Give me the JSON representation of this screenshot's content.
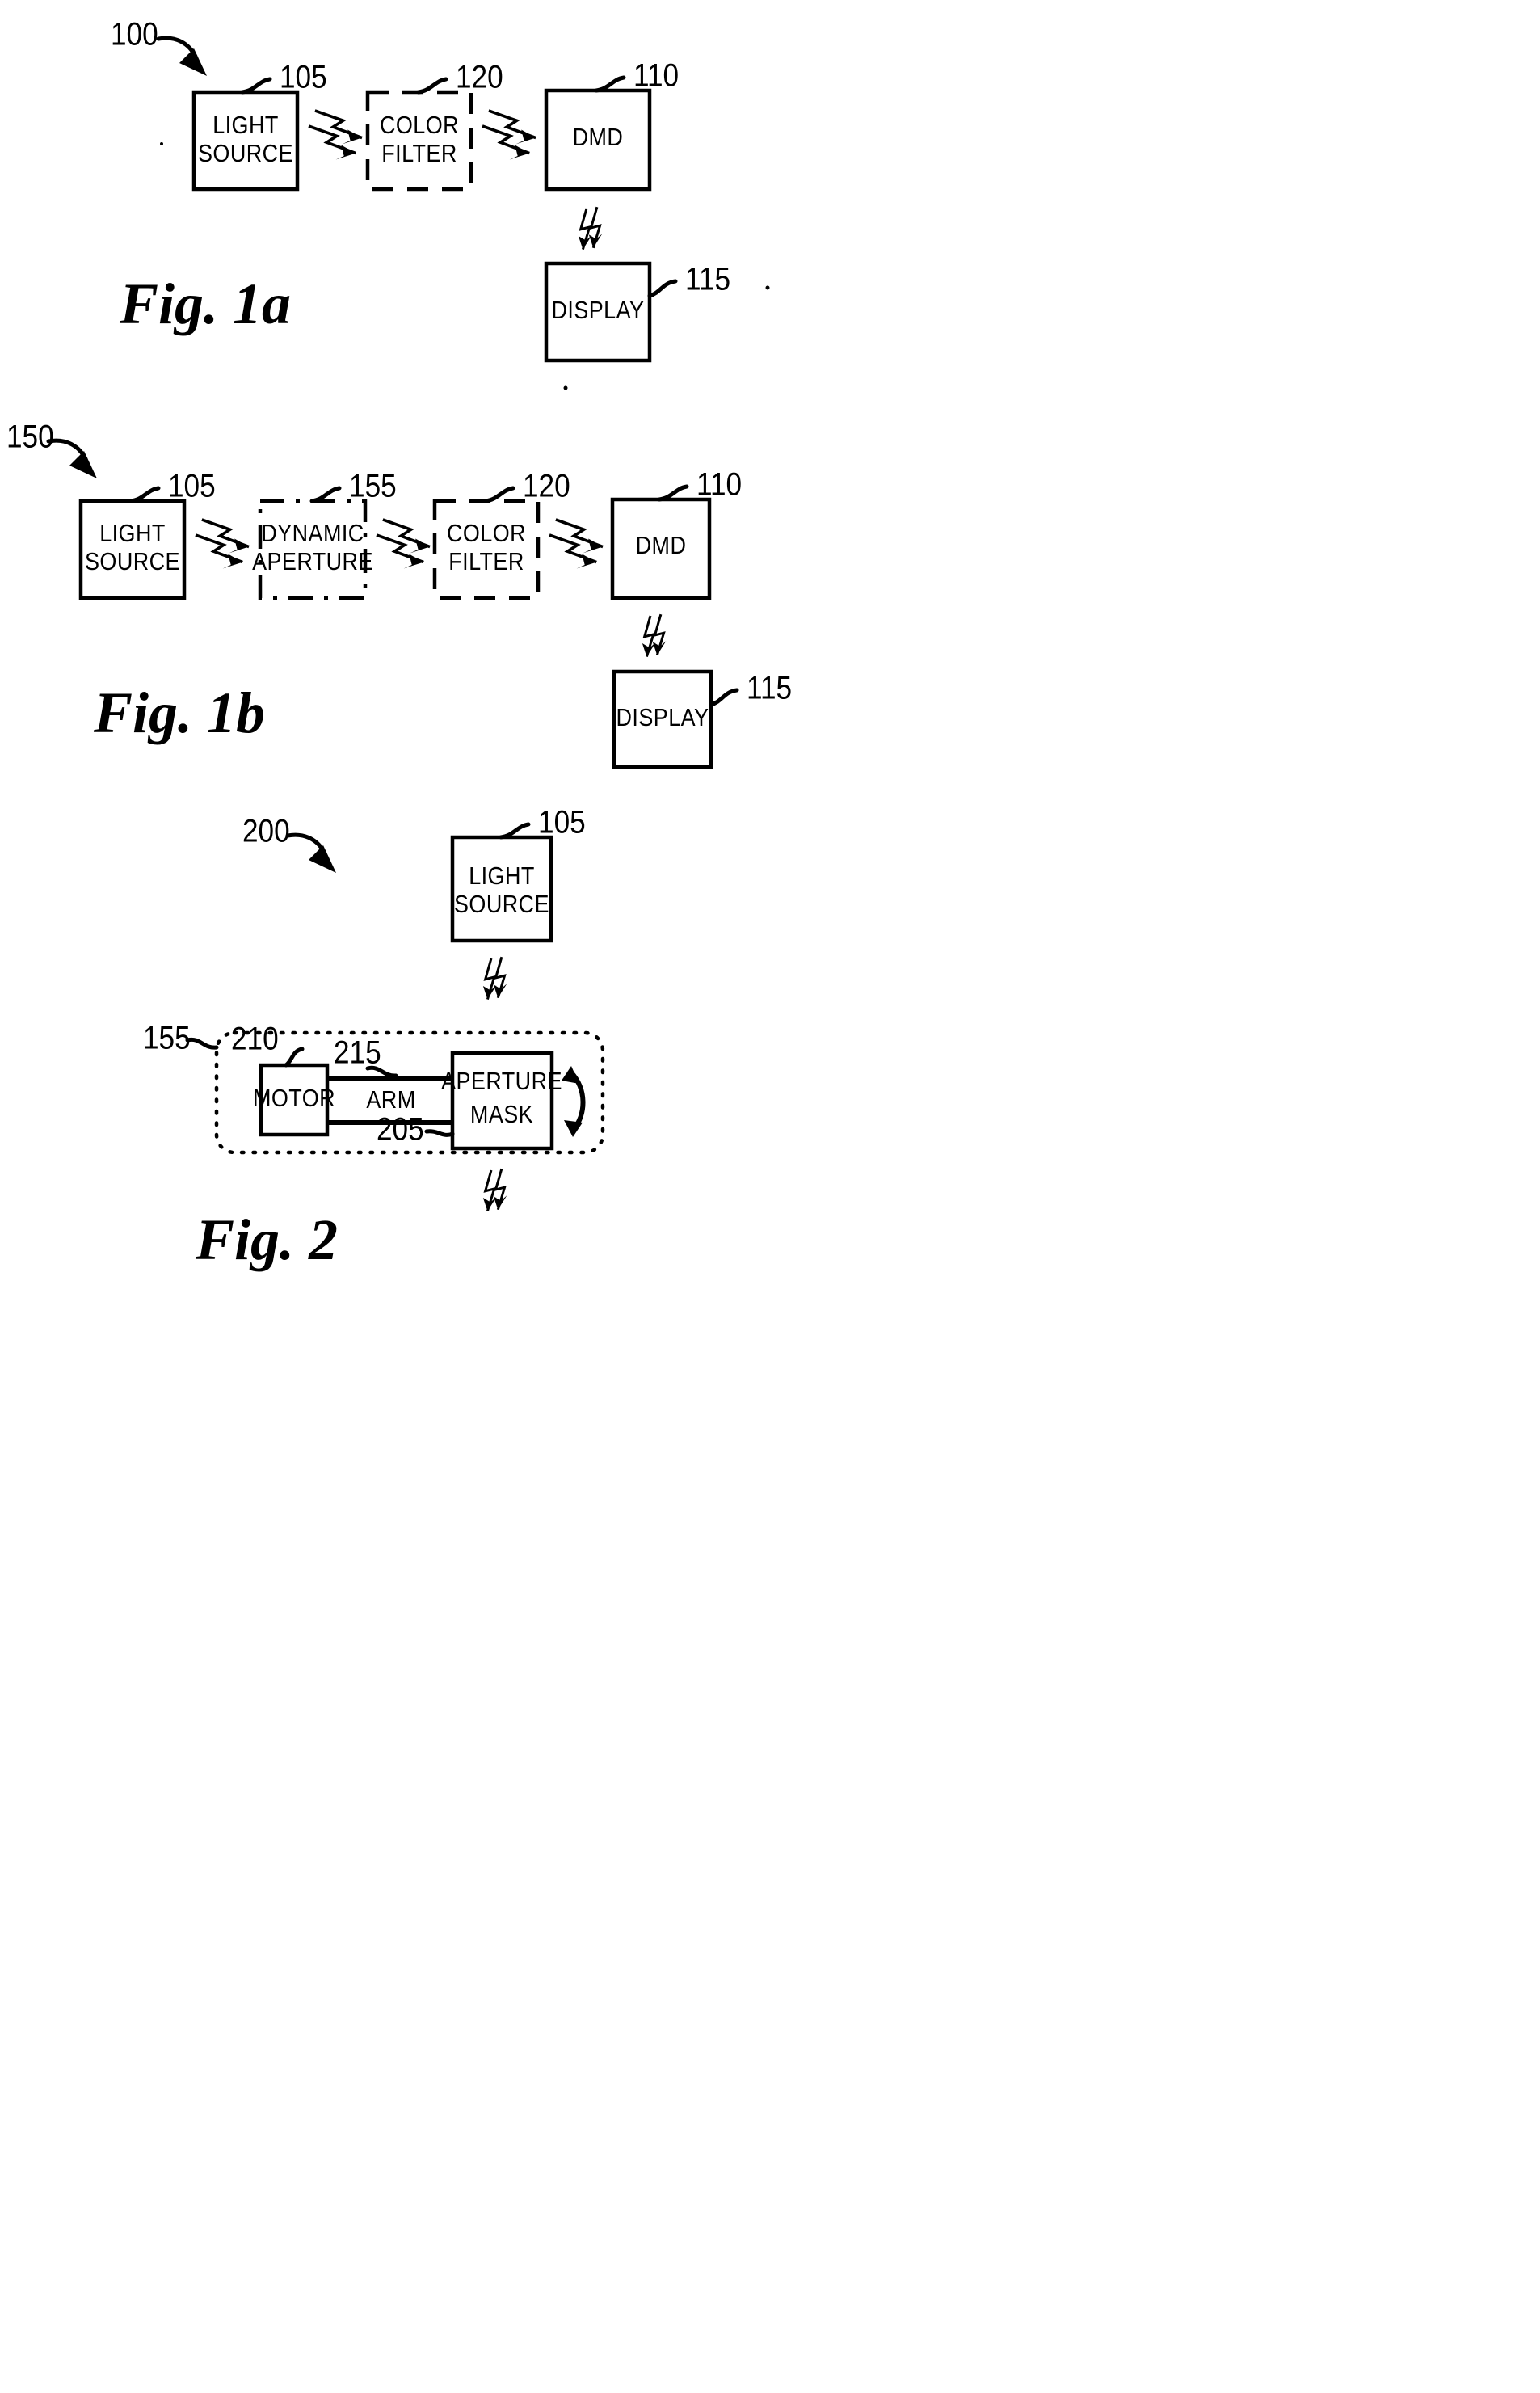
{
  "document": {
    "kind": "patent-figure-sheet",
    "background_color": "#ffffff",
    "ink_color": "#000000"
  },
  "figures": [
    {
      "id": "fig-1a",
      "caption": "Fig. 1a",
      "system_ref": "100",
      "blocks": [
        {
          "id": "light-source",
          "label_line1": "LIGHT",
          "label_line2": "SOURCE",
          "ref": "105",
          "border": "solid"
        },
        {
          "id": "color-filter",
          "label_line1": "COLOR",
          "label_line2": "FILTER",
          "ref": "120",
          "border": "dashed"
        },
        {
          "id": "dmd",
          "label_line1": "DMD",
          "label_line2": "",
          "ref": "110",
          "border": "solid"
        },
        {
          "id": "display",
          "label_line1": "DISPLAY",
          "label_line2": "",
          "ref": "115",
          "border": "solid"
        }
      ]
    },
    {
      "id": "fig-1b",
      "caption": "Fig. 1b",
      "system_ref": "150",
      "blocks": [
        {
          "id": "light-source",
          "label_line1": "LIGHT",
          "label_line2": "SOURCE",
          "ref": "105",
          "border": "solid"
        },
        {
          "id": "dynamic-aperture",
          "label_line1": "DYNAMIC",
          "label_line2": "APERTURE",
          "ref": "155",
          "border": "dash-dot"
        },
        {
          "id": "color-filter",
          "label_line1": "COLOR",
          "label_line2": "FILTER",
          "ref": "120",
          "border": "dashed"
        },
        {
          "id": "dmd",
          "label_line1": "DMD",
          "label_line2": "",
          "ref": "110",
          "border": "solid"
        },
        {
          "id": "display",
          "label_line1": "DISPLAY",
          "label_line2": "",
          "ref": "115",
          "border": "solid"
        }
      ]
    },
    {
      "id": "fig-2",
      "caption": "Fig. 2",
      "system_ref": "200",
      "enclosure_ref": "155",
      "blocks": [
        {
          "id": "light-source",
          "label_line1": "LIGHT",
          "label_line2": "SOURCE",
          "ref": "105",
          "border": "solid"
        },
        {
          "id": "motor",
          "label_line1": "MOTOR",
          "label_line2": "",
          "ref": "210",
          "border": "solid"
        },
        {
          "id": "arm",
          "label_line1": "ARM",
          "label_line2": "",
          "ref": "215",
          "border": "none"
        },
        {
          "id": "aperture-mask",
          "label_line1": "APERTURE",
          "label_line2": "MASK",
          "ref": "205",
          "border": "solid"
        }
      ]
    }
  ],
  "labels": {
    "light_line1": "LIGHT",
    "light_line2": "SOURCE",
    "color_line1": "COLOR",
    "color_line2": "FILTER",
    "dmd": "DMD",
    "display": "DISPLAY",
    "dynamic_line1": "DYNAMIC",
    "dynamic_line2": "APERTURE",
    "motor": "MOTOR",
    "arm": "ARM",
    "aperture_line1": "APERTURE",
    "aperture_line2": "MASK"
  },
  "refs": {
    "r100": "100",
    "r105": "105",
    "r110": "110",
    "r115": "115",
    "r120": "120",
    "r150": "150",
    "r155": "155",
    "r200": "200",
    "r205": "205",
    "r210": "210",
    "r215": "215"
  },
  "captions": {
    "fig1a": "Fig. 1a",
    "fig1b": "Fig. 1b",
    "fig2": "Fig. 2"
  }
}
